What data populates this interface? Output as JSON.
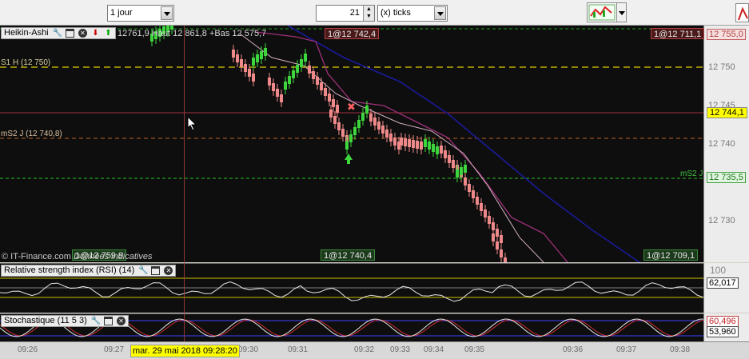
{
  "toolbar": {
    "period": "1 jour",
    "ticks_value": "21",
    "ticks_unit": "(x) ticks"
  },
  "main_chart": {
    "indicator_name": "Heikin-Ashi",
    "indicator_values": "12761,9 Haut 12 861,8 +Bas 12 575,7",
    "orders_top_mid": "1@12 742,4",
    "orders_top_right": "1@12 711,1",
    "orders_bottom_left": "1@12 759,9",
    "orders_bottom_mid": "1@12 740,4",
    "orders_bottom_right": "1@12 709,1",
    "level_s1": "S1 H (12 750)",
    "level_ms2": "mS2 J (12 740,8)",
    "level_ms2_right": "mS2 J",
    "source": "© IT-Finance.com",
    "source_note": "Données indicatives",
    "price_axis": [
      "12 750",
      "12 745",
      "12 740",
      "12 730"
    ],
    "axis_top": "12 755,0",
    "current_price": "12 744,1",
    "green_level": "12 735,5"
  },
  "rsi": {
    "title": "Relative strength index (RSI) (14)",
    "axis_top": "100",
    "value": "62,017"
  },
  "stoch": {
    "title": "Stochastique (11 5 3)",
    "value1": "60,496",
    "value2": "53,960"
  },
  "time_axis": {
    "ticks": [
      "09:26",
      "09:27",
      "09:30",
      "09:31",
      "09:32",
      "09:33",
      "09:34",
      "09:35",
      "09:36",
      "09:37",
      "09:38"
    ],
    "cursor_date": "mar. 29 mai 2018 09:28:20"
  },
  "colors": {
    "bull": "#3dd63d",
    "bear": "#f08a8a",
    "ma_blue": "#1a1a9a",
    "ma_purple": "#a0307a",
    "ma_light": "#d0b0c0",
    "level_yellow": "#e0d000",
    "level_orange": "#c06020",
    "level_green": "#20a020",
    "current_bg": "#ffff00"
  }
}
